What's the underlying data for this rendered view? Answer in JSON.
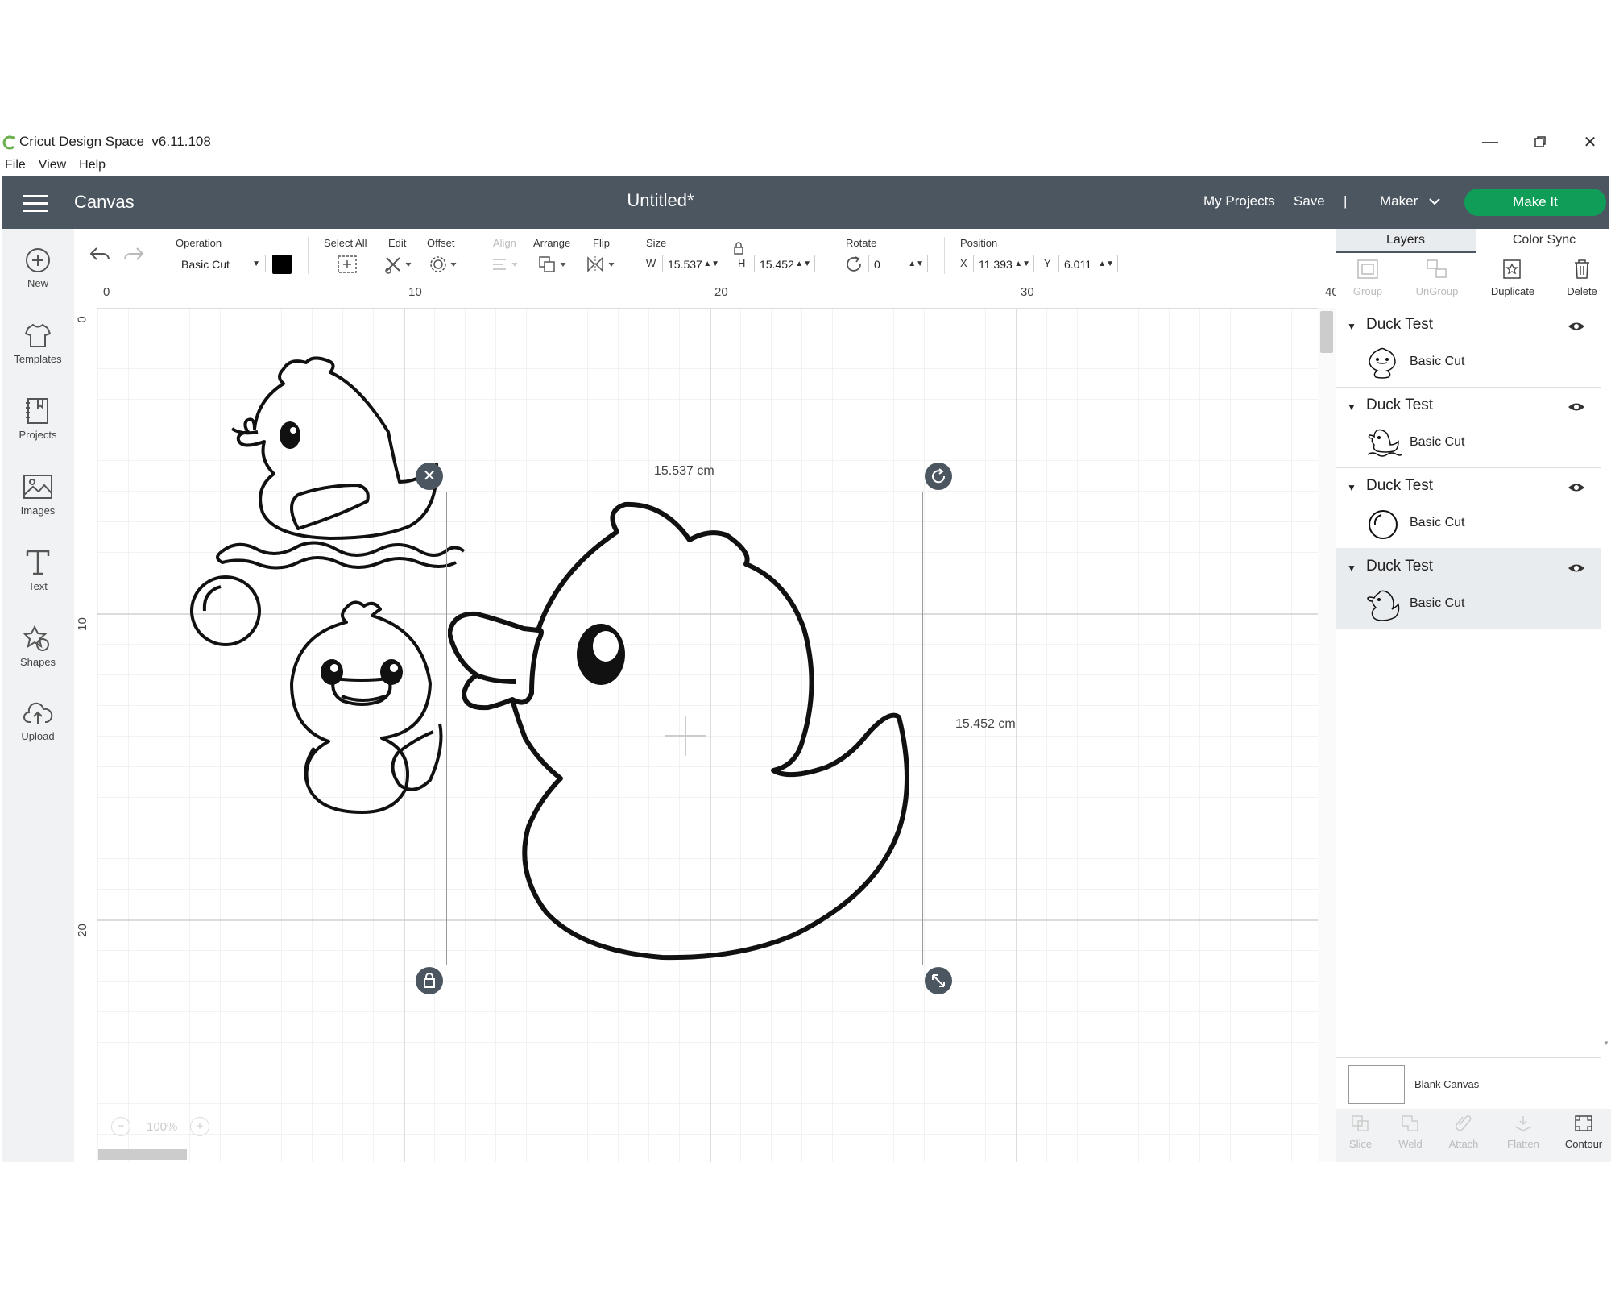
{
  "window": {
    "title": "Cricut Design Space",
    "version": "v6.11.108",
    "menu": [
      "File",
      "View",
      "Help"
    ]
  },
  "header": {
    "canvas_label": "Canvas",
    "doc_title": "Untitled*",
    "my_projects": "My Projects",
    "save": "Save",
    "divider": "|",
    "machine": "Maker",
    "make_it": "Make It"
  },
  "leftnav": {
    "items": [
      {
        "label": "New",
        "icon": "plus-circle-icon"
      },
      {
        "label": "Templates",
        "icon": "tshirt-icon"
      },
      {
        "label": "Projects",
        "icon": "projects-icon"
      },
      {
        "label": "Images",
        "icon": "image-icon"
      },
      {
        "label": "Text",
        "icon": "text-icon"
      },
      {
        "label": "Shapes",
        "icon": "shapes-icon"
      },
      {
        "label": "Upload",
        "icon": "cloud-upload-icon"
      }
    ]
  },
  "toolbar": {
    "operation_label": "Operation",
    "operation_value": "Basic Cut",
    "operation_color": "#000000",
    "select_all": "Select All",
    "edit": "Edit",
    "offset": "Offset",
    "align": "Align",
    "arrange": "Arrange",
    "flip": "Flip",
    "size": "Size",
    "w_label": "W",
    "w_value": "15.537",
    "h_label": "H",
    "h_value": "15.452",
    "rotate": "Rotate",
    "rotate_value": "0",
    "position": "Position",
    "x_label": "X",
    "x_value": "11.393",
    "y_label": "Y",
    "y_value": "6.011"
  },
  "canvas": {
    "ruler_top": [
      "0",
      "10",
      "20",
      "30",
      "40"
    ],
    "ruler_left": [
      "0",
      "10",
      "20"
    ],
    "width_readout": "15.537 cm",
    "height_readout": "15.452 cm",
    "zoom": "100%"
  },
  "panel": {
    "tabs": [
      "Layers",
      "Color Sync"
    ],
    "tools": [
      {
        "label": "Group",
        "enabled": false
      },
      {
        "label": "UnGroup",
        "enabled": false
      },
      {
        "label": "Duplicate",
        "enabled": true
      },
      {
        "label": "Delete",
        "enabled": true
      }
    ],
    "layers": [
      {
        "name": "Duck Test",
        "operation": "Basic Cut",
        "thumb": "duck-front-icon"
      },
      {
        "name": "Duck Test",
        "operation": "Basic Cut",
        "thumb": "duck-swimming-icon"
      },
      {
        "name": "Duck Test",
        "operation": "Basic Cut",
        "thumb": "bubble-icon"
      },
      {
        "name": "Duck Test",
        "operation": "Basic Cut",
        "thumb": "duck-side-icon"
      }
    ],
    "blank_canvas": "Blank Canvas",
    "bottom_tools": [
      {
        "label": "Slice",
        "enabled": false
      },
      {
        "label": "Weld",
        "enabled": false
      },
      {
        "label": "Attach",
        "enabled": false
      },
      {
        "label": "Flatten",
        "enabled": false
      },
      {
        "label": "Contour",
        "enabled": true
      }
    ]
  }
}
